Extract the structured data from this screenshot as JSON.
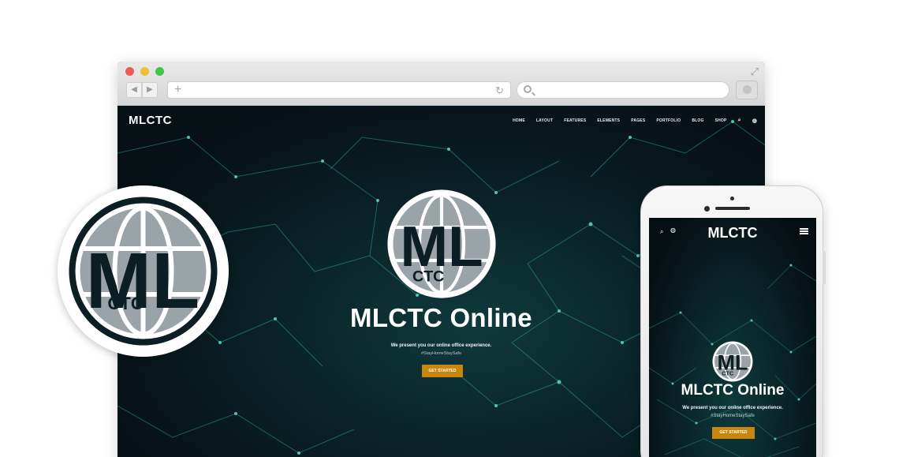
{
  "browser": {
    "traffic_lights": [
      "close",
      "minimize",
      "zoom"
    ],
    "back_icon": "◀",
    "forward_icon": "▶",
    "new_tab_icon": "+",
    "reload_icon": "↻",
    "expand_icon": "⤢"
  },
  "site": {
    "brand": "MLCTC",
    "nav": [
      "HOME",
      "LAYOUT",
      "FEATURES",
      "ELEMENTS",
      "PAGES",
      "PORTFOLIO",
      "BLOG",
      "SHOP"
    ],
    "hero": {
      "emblem_letters": "ML",
      "emblem_sub": "CTC",
      "title": "MLCTC Online",
      "subtitle": "We present you our online office experience.",
      "tagline": "#StayHomeStaySafe",
      "cta": "GET STARTED"
    }
  },
  "badge": {
    "letters": "ML",
    "sub": "CTC"
  },
  "phone": {
    "brand": "MLCTC",
    "hero": {
      "title": "MLCTC Online",
      "subtitle": "We present you our online office experience.",
      "tagline": "#StayHomeStaySafe",
      "cta": "GET STARTED"
    }
  },
  "colors": {
    "accent": "#c9860f",
    "background_dark": "#0a2226",
    "emblem_gray": "#9aa3a7",
    "emblem_dark": "#0b1e24"
  }
}
